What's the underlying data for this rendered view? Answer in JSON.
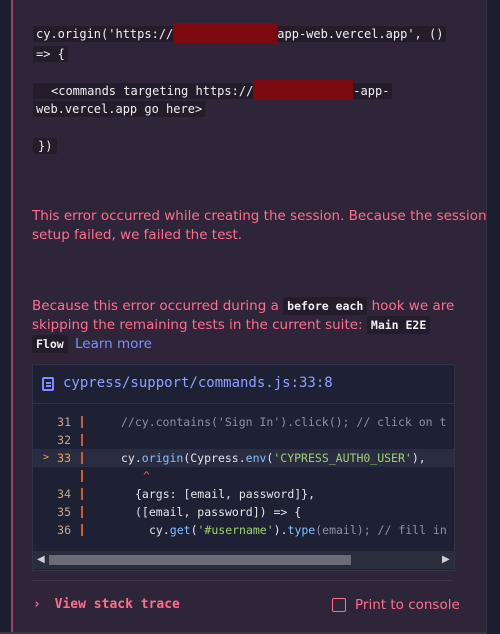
{
  "snippet": {
    "line1_prefix": "cy.origin('https://",
    "line1_suffix": "app-web.vercel.app', ()",
    "line2": "=> {",
    "line3_prefix": "<commands targeting https://",
    "line3_suffix": "-app-",
    "line4": "web.vercel.app go here>",
    "line5": "})"
  },
  "errors": {
    "session_line1": "This error occurred while creating the session. Because the session",
    "session_line2": "setup failed, we failed the test.",
    "hook_pre": "Because this error occurred during a",
    "hook_code": "before each",
    "hook_post": "hook we are",
    "skip_pre": "skipping the remaining tests in the current suite:",
    "suite_code_a": "Main E2E",
    "suite_code_b": "Flow",
    "learn_more": "Learn more"
  },
  "file": {
    "icon": "document-icon",
    "path": "cypress/support/commands.js:33:8"
  },
  "code_lines": [
    {
      "num": "31",
      "text": "//cy.contains('Sign In').click(); // click on t"
    },
    {
      "num": "32",
      "text": ""
    },
    {
      "num": "33",
      "text_pre": "cy.",
      "fn": "origin",
      "text_mid": "(Cypress.",
      "fn2": "env",
      "text_open": "(",
      "str": "'CYPRESS_AUTH0_USER'",
      "text_end": "),"
    },
    {
      "num": "",
      "caret": "^"
    },
    {
      "num": "34",
      "text": "{args: [email, password]},"
    },
    {
      "num": "35",
      "text": "([email, password]) => {"
    },
    {
      "num": "36",
      "text_pre": "cy.",
      "fn": "get",
      "text_mid": "(",
      "str": "'#username'",
      "text_open": ").",
      "fn2": "type",
      "text_end": "(email); // fill in"
    }
  ],
  "footer": {
    "stack_label": "Print to console",
    "view_stack": "View stack trace",
    "chevron": "chevron-right-icon",
    "console_icon": "console-icon"
  },
  "colors": {
    "error": "#ff6e8f",
    "link": "#7c8fff",
    "panel": "#2f2538"
  }
}
